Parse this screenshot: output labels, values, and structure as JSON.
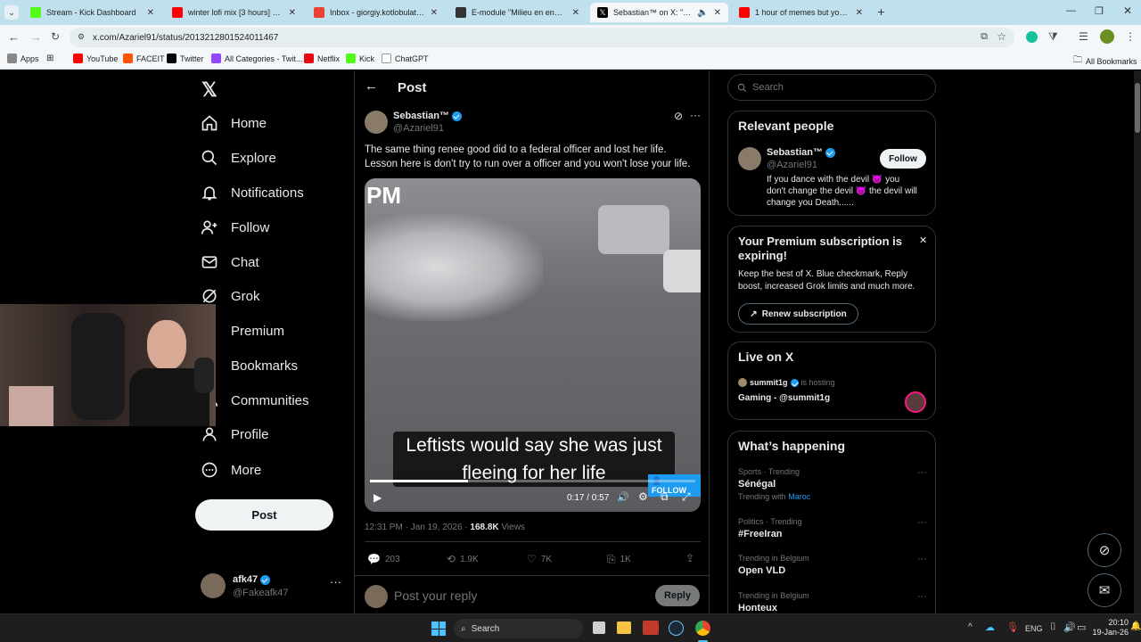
{
  "browser": {
    "tabs": [
      {
        "title": "Stream - Kick Dashboard",
        "color": "#53fc18"
      },
      {
        "title": "winter lofi mix [3 hours] ❄️ rela",
        "color": "#ff0000"
      },
      {
        "title": "Inbox - giorgiy.kotlobulat@vda",
        "color": "#ea4335"
      },
      {
        "title": "E-module \"Milieu en energie in",
        "color": "#333333"
      },
      {
        "title": "Sebastian™ on X: \"The same",
        "color": "#000000"
      },
      {
        "title": "1 hour of memes but you will la",
        "color": "#ff0000"
      }
    ],
    "url": "x.com/Azariel91/status/2013212801524011467",
    "bookmarks": [
      {
        "label": "Apps",
        "color": "#555555"
      },
      {
        "label": "YouTube",
        "color": "#ff0000"
      },
      {
        "label": "FACEIT",
        "color": "#ff5500"
      },
      {
        "label": "Twitter",
        "color": "#000000"
      },
      {
        "label": "All Categories - Twit...",
        "color": "#9146ff"
      },
      {
        "label": "Netflix",
        "color": "#e50914"
      },
      {
        "label": "Kick",
        "color": "#53fc18"
      },
      {
        "label": "ChatGPT",
        "color": "#ffffff"
      }
    ],
    "all_bookmarks": "All Bookmarks"
  },
  "nav": {
    "items": [
      "Home",
      "Explore",
      "Notifications",
      "Follow",
      "Chat",
      "Grok",
      "Premium",
      "Bookmarks",
      "Communities",
      "Profile",
      "More"
    ],
    "post_button": "Post",
    "account": {
      "name": "afk47",
      "handle": "@Fakeafk47"
    }
  },
  "post": {
    "header": "Post",
    "author": {
      "name": "Sebastian™",
      "handle": "@Azariel91"
    },
    "text_line1": "The same thing renee good did to a federal officer and lost her life.",
    "text_line2": "Lesson here is don't try to run over a officer and you won't lose your life.",
    "video": {
      "corner_text": "PM",
      "caption_line1": "Leftists would say she was just",
      "caption_line2": "fleeing for her life",
      "follow_badge": "FOLLOW",
      "time": "0:17 / 0:57",
      "progress": 0.3
    },
    "timestamp": "12:31 PM · Jan 19, 2026 ·",
    "views_count": "168.8K",
    "views_label": "Views",
    "stats": {
      "replies": "203",
      "reposts": "1.9K",
      "likes": "7K",
      "bookmarks": "1K"
    },
    "reply_placeholder": "Post your reply",
    "reply_button": "Reply"
  },
  "sidebar": {
    "search_placeholder": "Search",
    "relevant": {
      "title": "Relevant people",
      "name": "Sebastian™",
      "handle": "@Azariel91",
      "follow": "Follow",
      "bio_line1": "If you dance with the devil 😈 you",
      "bio_line2": "don't change the devil 😈 the devil will",
      "bio_line3": "change you Death......"
    },
    "premium": {
      "title_line1": "Your Premium subscription is",
      "title_line2": "expiring!",
      "body_line1": "Keep the best of X. Blue checkmark, Reply",
      "body_line2": "boost, increased Grok limits and much more.",
      "button": "Renew subscription"
    },
    "live": {
      "title": "Live on X",
      "host": "summit1g",
      "hosting": "is hosting",
      "stream": "Gaming - @summit1g"
    },
    "happening": {
      "title": "What’s happening",
      "items": [
        {
          "meta": "Sports · Trending",
          "topic": "Sénégal",
          "extra_prefix": "Trending with",
          "extra_link": "Maroc"
        },
        {
          "meta": "Politics · Trending",
          "topic": "#FreeIran"
        },
        {
          "meta": "Trending in Belgium",
          "topic": "Open VLD"
        },
        {
          "meta": "Trending in Belgium",
          "topic": "Honteux"
        }
      ]
    }
  },
  "taskbar": {
    "search": "Search",
    "lang": "ENG",
    "time": "20:10",
    "date": "19-Jan-26"
  }
}
